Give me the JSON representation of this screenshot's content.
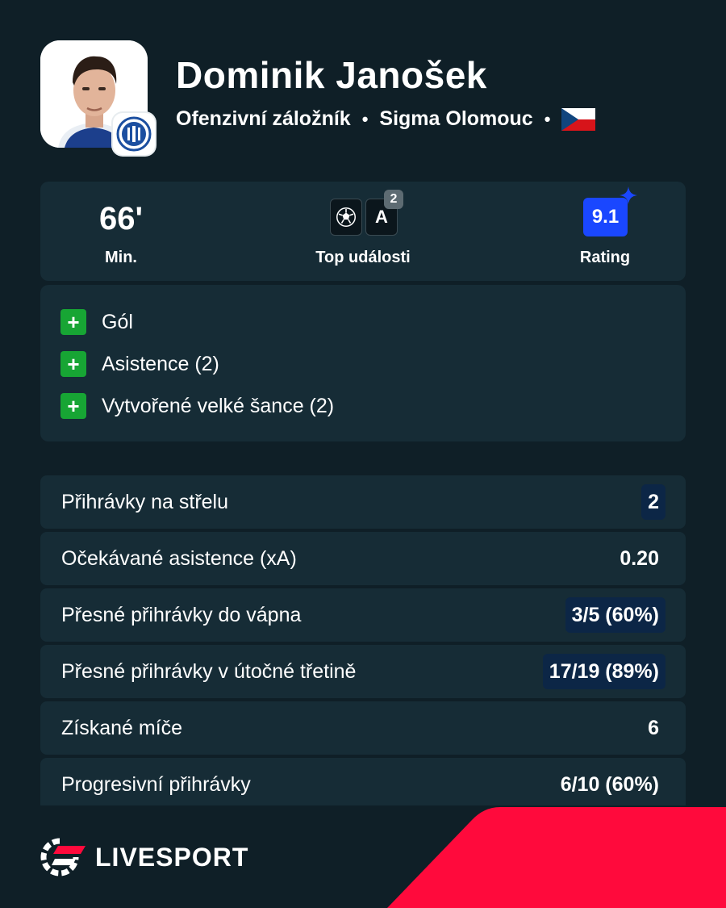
{
  "player": {
    "name": "Dominik Janošek",
    "position": "Ofenzivní záložník",
    "club": "Sigma Olomouc",
    "separator": "•",
    "country_flag": "czech-flag"
  },
  "summary": {
    "minutes_value": "66'",
    "minutes_label": "Min.",
    "top_events_label": "Top události",
    "top_events": [
      {
        "icon": "football-icon"
      },
      {
        "text": "A",
        "count": "2"
      }
    ],
    "rating_value": "9.1",
    "rating_label": "Rating"
  },
  "highlights": [
    {
      "label": "Gól"
    },
    {
      "label": "Asistence (2)"
    },
    {
      "label": "Vytvořené velké šance (2)"
    }
  ],
  "stats": [
    {
      "label": "Přihrávky na střelu",
      "value": "2",
      "highlight": true
    },
    {
      "label": "Očekávané asistence (xA)",
      "value": "0.20",
      "highlight": false
    },
    {
      "label": "Přesné přihrávky do vápna",
      "value": "3/5 (60%)",
      "highlight": true
    },
    {
      "label": "Přesné přihrávky v útočné třetině",
      "value": "17/19 (89%)",
      "highlight": true
    },
    {
      "label": "Získané míče",
      "value": "6",
      "highlight": false
    },
    {
      "label": "Progresivní přihrávky",
      "value": "6/10 (60%)",
      "highlight": false
    }
  ],
  "brand": {
    "name": "LIVESPORT"
  },
  "colors": {
    "background": "#0f1f27",
    "card": "#162c36",
    "rating_badge": "#1a47ff",
    "plus_badge": "#17a534",
    "value_highlight": "#0c2646",
    "accent_red": "#ff0a3c"
  }
}
